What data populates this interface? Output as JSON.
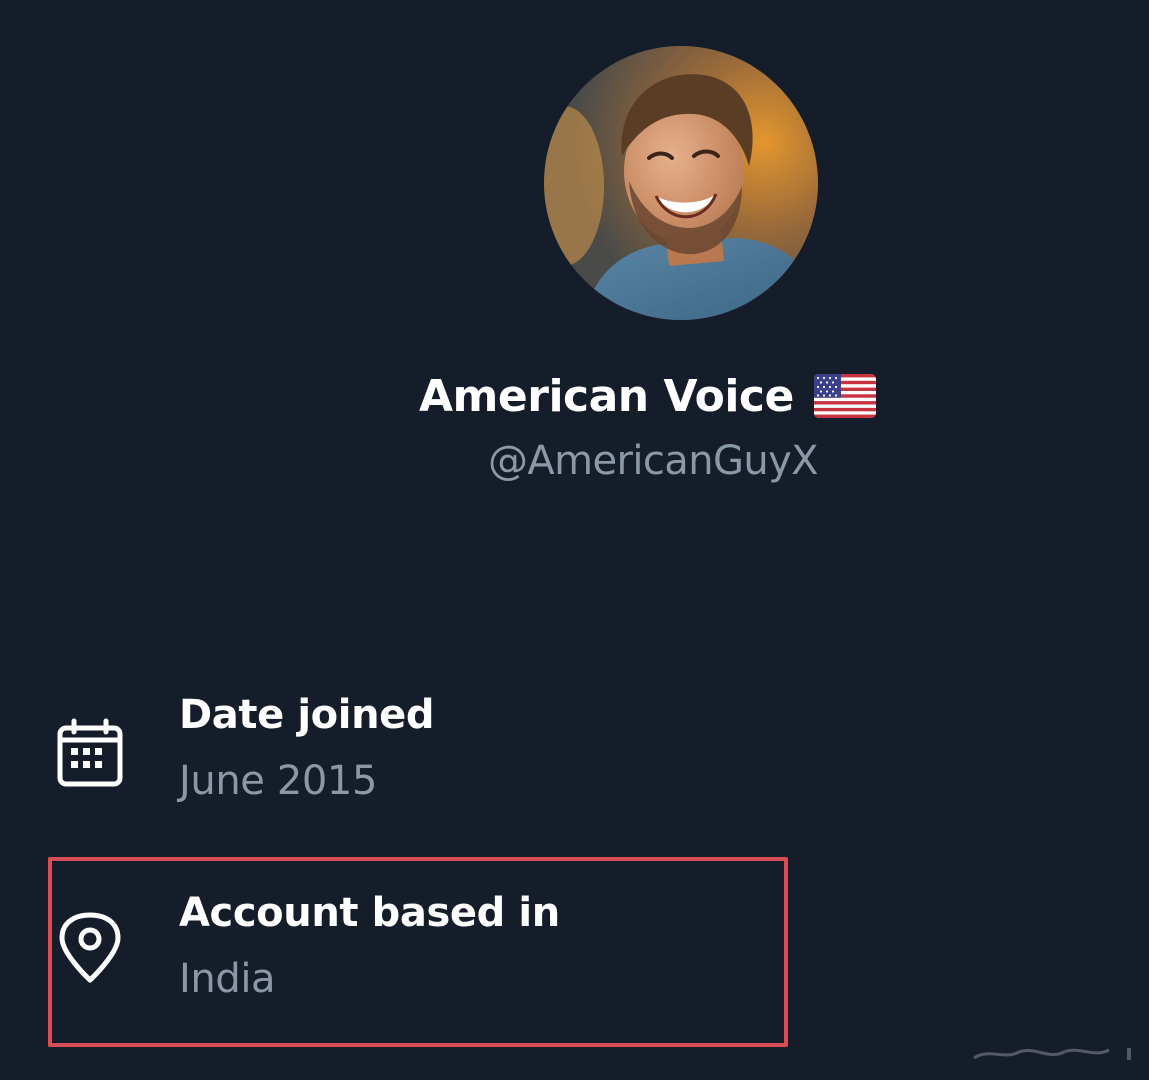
{
  "profile": {
    "display_name": "American Voice",
    "flag_icon": "us-flag-icon",
    "handle": "@AmericanGuyX"
  },
  "about": {
    "date_joined": {
      "icon": "calendar-icon",
      "label": "Date joined",
      "value": "June 2015"
    },
    "account_based_in": {
      "icon": "location-pin-icon",
      "label": "Account based in",
      "value": "India",
      "highlighted": true,
      "highlight_color": "#d94d55"
    }
  },
  "colors": {
    "background": "#151d2a",
    "primary_text": "#ffffff",
    "secondary_text": "#8b98a5"
  }
}
